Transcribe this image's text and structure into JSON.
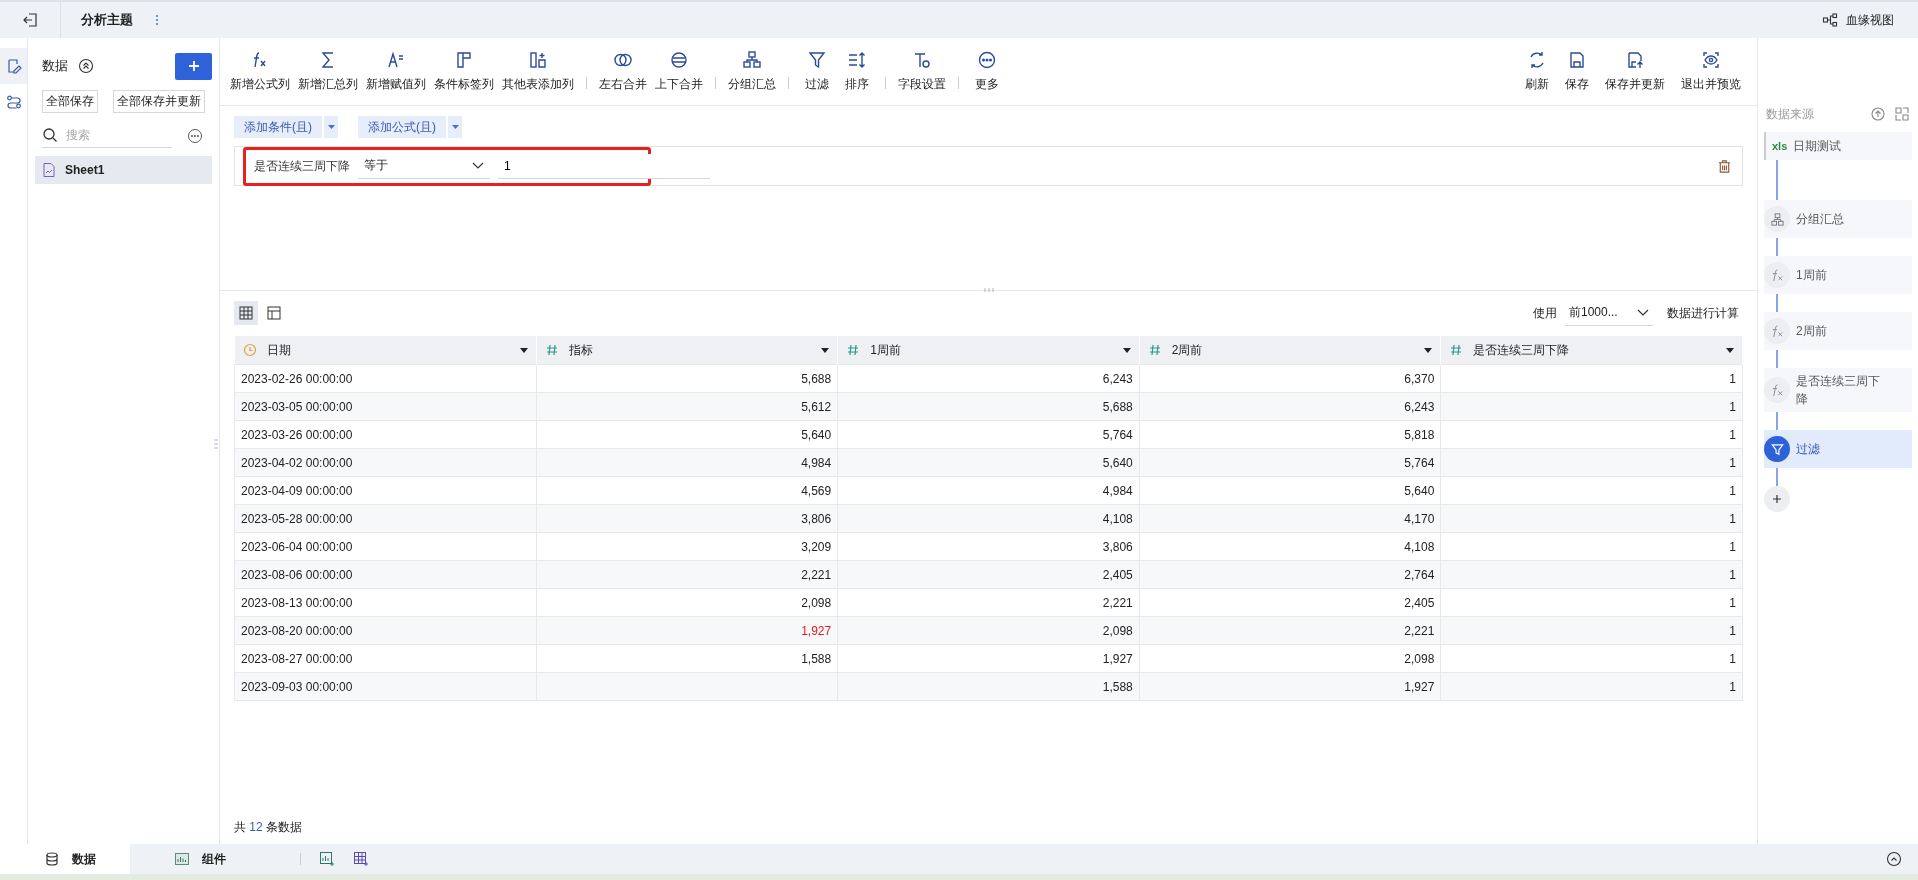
{
  "topbar": {
    "title": "分析主题",
    "lineage_label": "血缘视图"
  },
  "left_panel": {
    "title": "数据",
    "buttons": [
      "全部保存",
      "全部保存并更新"
    ],
    "search": {
      "placeholder": "搜索"
    },
    "items": [
      {
        "label": "Sheet1",
        "selected": true
      }
    ]
  },
  "toolbar": {
    "groups": [
      [
        {
          "kind": "formula",
          "label": "新增公式列"
        },
        {
          "kind": "sum",
          "label": "新增汇总列"
        },
        {
          "kind": "assign",
          "label": "新增赋值列"
        },
        {
          "kind": "tag",
          "label": "条件标签列"
        },
        {
          "kind": "addcol",
          "label": "其他表添加列"
        }
      ],
      [
        {
          "kind": "lrmerge",
          "label": "左右合并"
        },
        {
          "kind": "udmerge",
          "label": "上下合并"
        }
      ],
      [
        {
          "kind": "group",
          "label": "分组汇总"
        }
      ],
      [
        {
          "kind": "filter",
          "label": "过滤"
        },
        {
          "kind": "sort",
          "label": "排序"
        }
      ],
      [
        {
          "kind": "field",
          "label": "字段设置"
        }
      ],
      [
        {
          "kind": "more",
          "label": "更多"
        }
      ]
    ],
    "right": [
      {
        "kind": "refresh",
        "label": "刷新"
      },
      {
        "kind": "save",
        "label": "保存"
      },
      {
        "kind": "saveupdate",
        "label": "保存并更新"
      },
      {
        "kind": "preview",
        "label": "退出并预览"
      }
    ]
  },
  "filter": {
    "buttons": [
      "添加条件(且)",
      "添加公式(且)"
    ],
    "condition": {
      "field": "是否连续三周下降",
      "operator": "等于",
      "value": "1",
      "highlighted": true
    }
  },
  "table_toolbar": {
    "use_label": "使用",
    "limit": "前1000...",
    "suffix": "数据进行计算"
  },
  "table": {
    "columns": [
      {
        "kind": "date",
        "label": "日期"
      },
      {
        "kind": "number",
        "label": "指标"
      },
      {
        "kind": "number",
        "label": "1周前"
      },
      {
        "kind": "number",
        "label": "2周前"
      },
      {
        "kind": "number",
        "label": "是否连续三周下降"
      }
    ],
    "rows": [
      {
        "cells": [
          "2023-02-26 00:00:00",
          "5,688",
          "6,243",
          "6,370",
          "1"
        ]
      },
      {
        "cells": [
          "2023-03-05 00:00:00",
          "5,612",
          "5,688",
          "6,243",
          "1"
        ]
      },
      {
        "cells": [
          "2023-03-26 00:00:00",
          "5,640",
          "5,764",
          "5,818",
          "1"
        ]
      },
      {
        "cells": [
          "2023-04-02 00:00:00",
          "4,984",
          "5,640",
          "5,764",
          "1"
        ]
      },
      {
        "cells": [
          "2023-04-09 00:00:00",
          "4,569",
          "4,984",
          "5,640",
          "1"
        ]
      },
      {
        "cells": [
          "2023-05-28 00:00:00",
          "3,806",
          "4,108",
          "4,170",
          "1"
        ]
      },
      {
        "cells": [
          "2023-06-04 00:00:00",
          "3,209",
          "3,806",
          "4,108",
          "1"
        ]
      },
      {
        "cells": [
          "2023-08-06 00:00:00",
          "2,221",
          "2,405",
          "2,764",
          "1"
        ]
      },
      {
        "cells": [
          "2023-08-13 00:00:00",
          "2,098",
          "2,221",
          "2,405",
          "1"
        ]
      },
      {
        "cells": [
          "2023-08-20 00:00:00",
          {
            "text": "1,927",
            "warning": true
          },
          "2,098",
          "2,221",
          "1"
        ]
      },
      {
        "cells": [
          "2023-08-27 00:00:00",
          "1,588",
          "1,927",
          "2,098",
          "1"
        ]
      },
      {
        "cells": [
          "2023-09-03 00:00:00",
          "",
          "1,588",
          "1,927",
          "1"
        ]
      }
    ]
  },
  "row_count": {
    "prefix": "共",
    "count": "12",
    "suffix": "条数据"
  },
  "steps_panel": {
    "title": "数据来源",
    "steps": [
      {
        "kind": "source",
        "badge": "xls",
        "label": "日期测试",
        "selected": false
      },
      {
        "kind": "group",
        "label": "分组汇总",
        "selected": false
      },
      {
        "kind": "formula",
        "label": "1周前",
        "selected": false
      },
      {
        "kind": "formula",
        "label": "2周前",
        "selected": false
      },
      {
        "kind": "formula",
        "label": "是否连续三周下降",
        "selected": false
      },
      {
        "kind": "filter",
        "label": "过滤",
        "selected": true
      }
    ]
  },
  "bottom_tabs": [
    {
      "kind": "data",
      "label": "数据",
      "selected": true
    },
    {
      "kind": "component",
      "label": "组件",
      "selected": false
    }
  ]
}
